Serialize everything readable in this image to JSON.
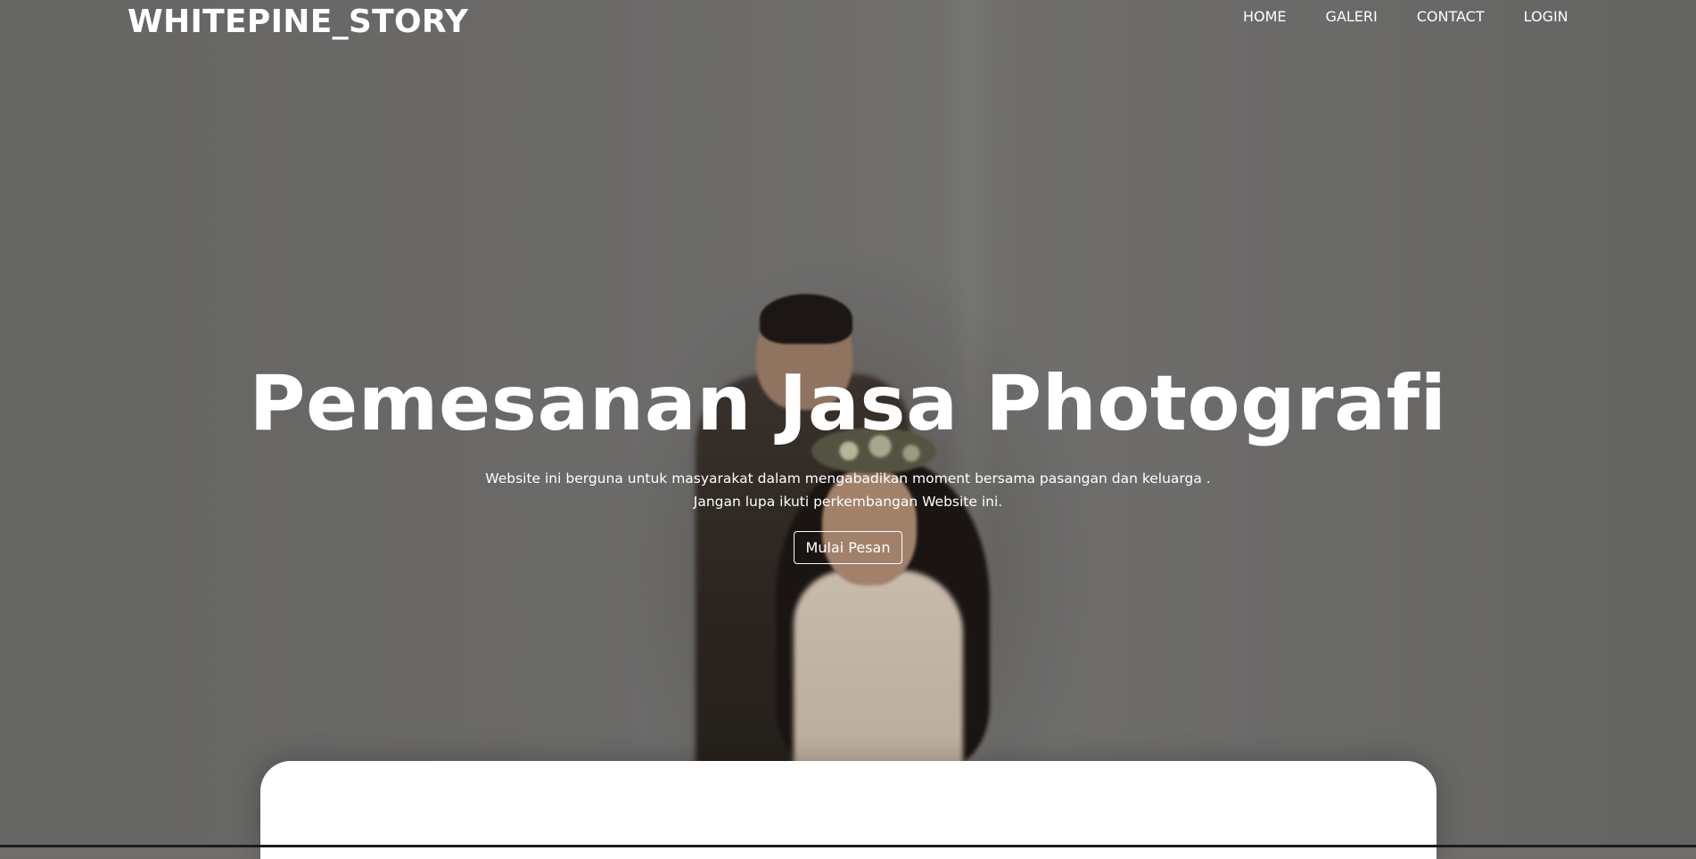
{
  "brand": "WHITEPINE_STORY",
  "nav": {
    "home": "HOME",
    "galeri": "GALERI",
    "contact": "CONTACT",
    "login": "LOGIN"
  },
  "hero": {
    "title": "Pemesanan Jasa Photografi",
    "subtitle_line1": "Website ini berguna untuk masyarakat dalam mengabadikan moment bersama pasangan dan keluarga .",
    "subtitle_line2": "Jangan lupa ikuti perkembangan Website ini.",
    "cta_label": "Mulai Pesan"
  },
  "colors": {
    "text": "#ffffff",
    "card": "#ffffff",
    "overlay": "#6f6e6c"
  }
}
